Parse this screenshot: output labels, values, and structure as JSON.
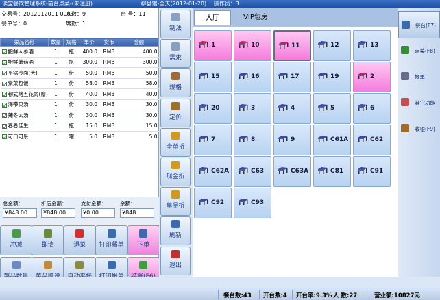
{
  "window": {
    "title": "读宝餐饮管理系统-前台点菜-(未注册)",
    "restaurant": "柳县馆-全天(2012-01-20)",
    "operator": "操作员：3"
  },
  "order": {
    "receipt_label": "交易号：2012012011 0003",
    "people_label": "人数：9",
    "table_label": "台 号：11",
    "meal_label": "餐单号：0",
    "seats_label": "席数：1"
  },
  "dish_table": {
    "headers": [
      "菜品名称",
      "数量",
      "规格",
      "单价",
      "货币",
      "金额"
    ],
    "rows": [
      [
        "鲍鲜人参酒",
        "1",
        "瓶",
        "400.0",
        "RMB",
        "400.0"
      ],
      [
        "鲍鲜蘑菇酒",
        "1",
        "瓶",
        "300.0",
        "RMB",
        "300.0"
      ],
      [
        "平锅冷面(大)",
        "1",
        "份",
        "50.0",
        "RMB",
        "50.0"
      ],
      [
        "紫菜包饭",
        "1",
        "份",
        "58.0",
        "RMB",
        "58.0"
      ],
      [
        "韧式烤五花肉(赠)",
        "1",
        "份",
        "40.0",
        "RMB",
        "40.0"
      ],
      [
        "海带贝汤",
        "1",
        "份",
        "30.0",
        "RMB",
        "30.0"
      ],
      [
        "辣冬太汤",
        "1",
        "份",
        "30.0",
        "RMB",
        "30.0"
      ],
      [
        "春卷佳生",
        "1",
        "瓶",
        "15.0",
        "RMB",
        "15.0"
      ],
      [
        "可口可乐",
        "1",
        "罐",
        "5.0",
        "RMB",
        "5.0"
      ]
    ]
  },
  "summary": {
    "total_label": "总金额：",
    "total_value": "¥848.00",
    "discount_label": "折后金额：",
    "discount_value": "¥848.00",
    "paid_label": "支付金额：",
    "paid_value": "¥0.00",
    "balance_label": "余额：",
    "balance_value": "¥848"
  },
  "bottom_buttons": [
    "冲减",
    "即清",
    "退菜",
    "打印餐单",
    "下单",
    "菜品数量",
    "菜品赠送",
    "自动平帐",
    "打印帐单",
    "结账(F6)"
  ],
  "mid_buttons": [
    "制法",
    "需求",
    "规格",
    "定价",
    "全单折",
    "现金折",
    "单品折",
    "刷新",
    "退出"
  ],
  "tabs": [
    "大厅",
    "VIP包房"
  ],
  "tables": [
    {
      "no": "1",
      "state": "open"
    },
    {
      "no": "10",
      "state": "open"
    },
    {
      "no": "11",
      "state": "open"
    },
    {
      "no": "12",
      "state": "free"
    },
    {
      "no": "13",
      "state": "free"
    },
    {
      "no": "15",
      "state": "free"
    },
    {
      "no": "16",
      "state": "free"
    },
    {
      "no": "17",
      "state": "free"
    },
    {
      "no": "19",
      "state": "free"
    },
    {
      "no": "2",
      "state": "open"
    },
    {
      "no": "20",
      "state": "free"
    },
    {
      "no": "3",
      "state": "free"
    },
    {
      "no": "4",
      "state": "free"
    },
    {
      "no": "5",
      "state": "free"
    },
    {
      "no": "6",
      "state": "free"
    },
    {
      "no": "7",
      "state": "free"
    },
    {
      "no": "8",
      "state": "free"
    },
    {
      "no": "9",
      "state": "free"
    },
    {
      "no": "C61A",
      "state": "free"
    },
    {
      "no": "C62",
      "state": "free"
    },
    {
      "no": "C62A",
      "state": "free"
    },
    {
      "no": "C63",
      "state": "free"
    },
    {
      "no": "C63A",
      "state": "free"
    },
    {
      "no": "C81",
      "state": "free"
    },
    {
      "no": "C91",
      "state": "free"
    },
    {
      "no": "C92",
      "state": "free"
    },
    {
      "no": "C93",
      "state": "free"
    }
  ],
  "selected_table": "11",
  "right_nav": [
    "餐台(F7)",
    "点菜(F8)",
    "帐单",
    "其它功能",
    "收银(F9)"
  ],
  "status": {
    "tables": "餐台数:43",
    "open": "开台数:4",
    "rate": "开台率:9.3%",
    "people": "人  数:27",
    "revenue": "营业额:10827元"
  },
  "colors": {
    "open_table": "#f47cdc",
    "free_table": "#b7d2f2",
    "tab_bar": "#a9c2e4"
  }
}
